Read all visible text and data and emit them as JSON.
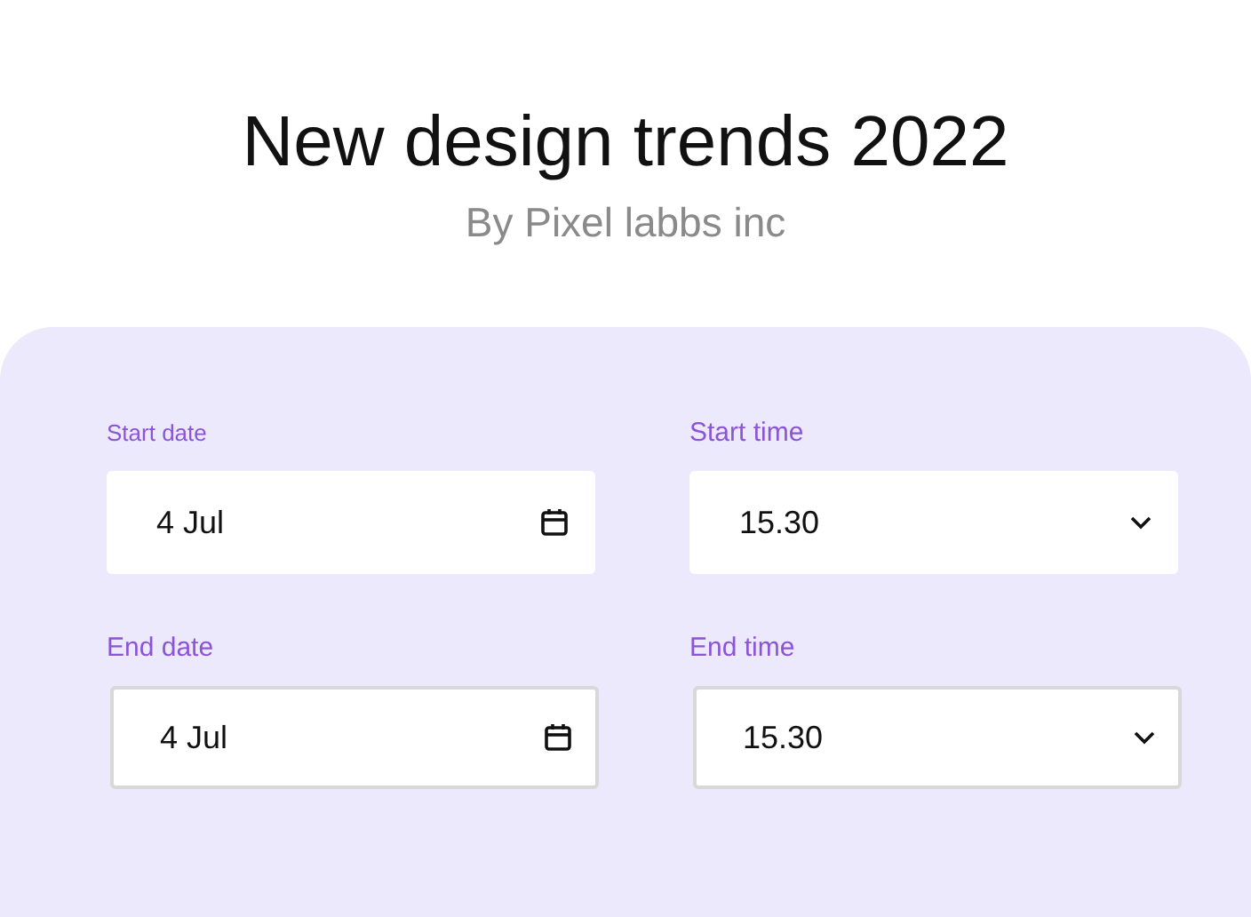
{
  "header": {
    "title": "New design trends 2022",
    "subtitle": "By Pixel labbs inc"
  },
  "fields": [
    {
      "label": "Start date",
      "value": "4 Jul",
      "kind": "date",
      "outlined": false
    },
    {
      "label": "Start time",
      "value": "15.30",
      "kind": "time",
      "outlined": false
    },
    {
      "label": "End date",
      "value": "4 Jul",
      "kind": "date",
      "outlined": true
    },
    {
      "label": "End time",
      "value": "15.30",
      "kind": "time",
      "outlined": true
    }
  ]
}
